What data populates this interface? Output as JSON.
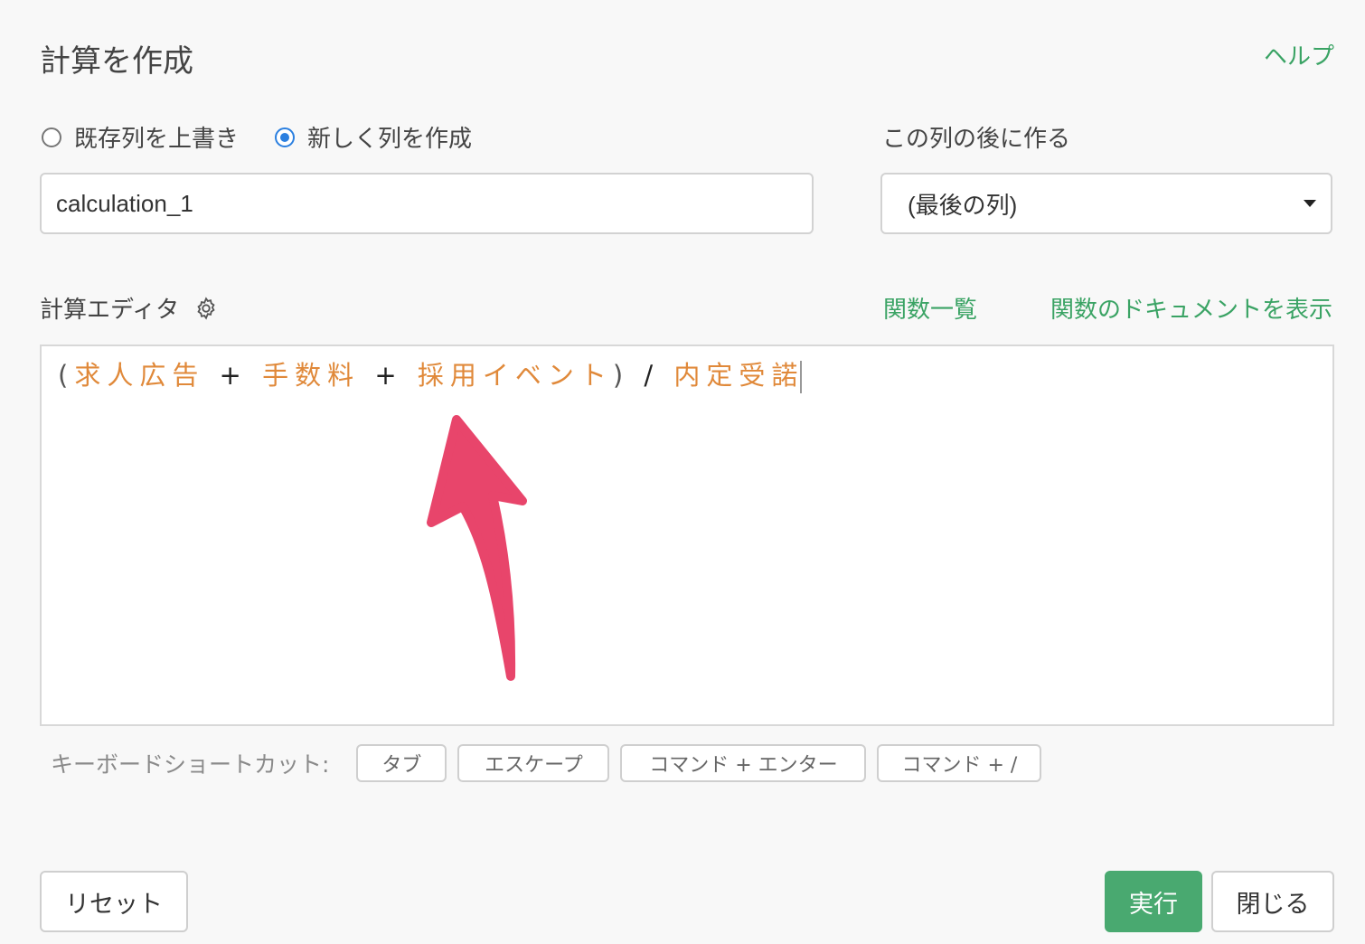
{
  "dialog": {
    "title": "計算を作成",
    "help_link": "ヘルプ"
  },
  "mode": {
    "overwrite_label": "既存列を上書き",
    "create_label": "新しく列を作成",
    "selected": "create"
  },
  "column_name": {
    "value": "calculation_1"
  },
  "position": {
    "label": "この列の後に作る",
    "selected": "(最後の列)"
  },
  "editor": {
    "label": "計算エディタ",
    "settings_icon": "gear-icon",
    "function_list_link": "関数一覧",
    "function_docs_link": "関数のドキュメントを表示",
    "formula_tokens": [
      {
        "type": "paren",
        "text": "("
      },
      {
        "type": "col",
        "text": "求人広告"
      },
      {
        "type": "op",
        "text": " + "
      },
      {
        "type": "col",
        "text": "手数料"
      },
      {
        "type": "op",
        "text": " + "
      },
      {
        "type": "col",
        "text": "採用イベント"
      },
      {
        "type": "paren",
        "text": ")"
      },
      {
        "type": "op",
        "text": " / "
      },
      {
        "type": "col",
        "text": "内定受諾"
      }
    ],
    "annotation": "arrow-pointer",
    "colors": {
      "column": "#e0893a",
      "operator": "#222222",
      "annotation_arrow": "#e8456b"
    }
  },
  "shortcuts": {
    "label": "キーボードショートカット:",
    "keys": [
      "タブ",
      "エスケープ",
      "コマンド + エンター",
      "コマンド + /"
    ]
  },
  "footer": {
    "reset_label": "リセット",
    "run_label": "実行",
    "close_label": "閉じる"
  },
  "colors": {
    "accent_green": "#3aa364",
    "primary_button": "#49a970",
    "radio_selected": "#2a7fe0"
  }
}
